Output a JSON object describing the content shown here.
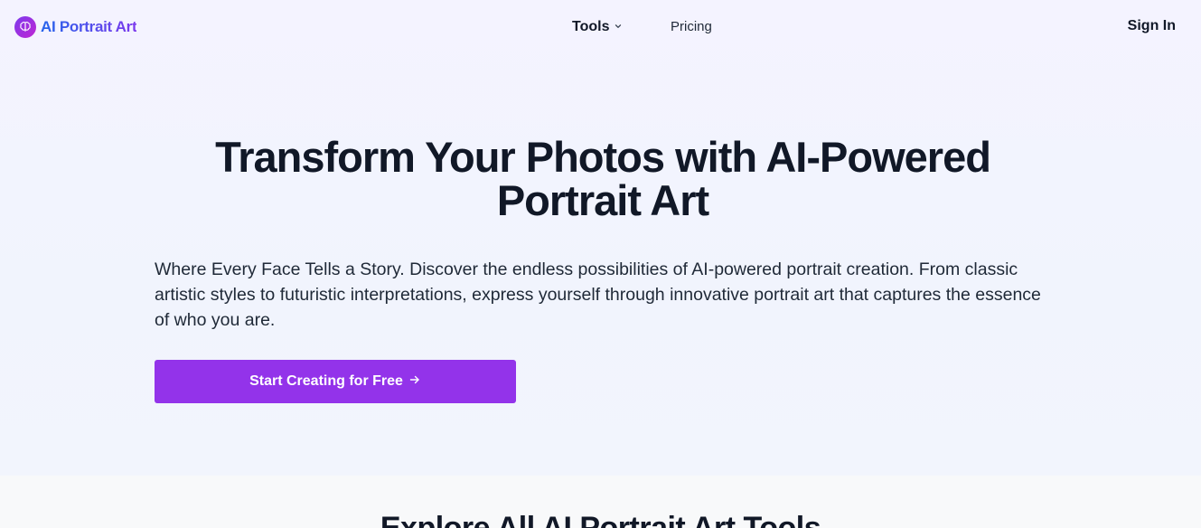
{
  "header": {
    "logo_text": "AI Portrait Art",
    "logo_icon": "brain-icon",
    "nav": {
      "tools_label": "Tools",
      "tools_icon": "chevron-down-icon",
      "pricing_label": "Pricing"
    },
    "sign_in_label": "Sign In"
  },
  "hero": {
    "title": "Transform Your Photos with AI-Powered Portrait Art",
    "subtitle": "Where Every Face Tells a Story. Discover the endless possibilities of AI-powered portrait creation. From classic artistic styles to futuristic interpretations, express yourself through innovative portrait art that captures the essence of who you are.",
    "cta_label": "Start Creating for Free",
    "cta_icon": "arrow-right-icon"
  },
  "tools_section": {
    "heading": "Explore All AI Portrait Art Tools"
  },
  "colors": {
    "accent": "#9333ea",
    "logo_gradient_start": "#2563eb",
    "logo_gradient_end": "#7c3aed"
  }
}
